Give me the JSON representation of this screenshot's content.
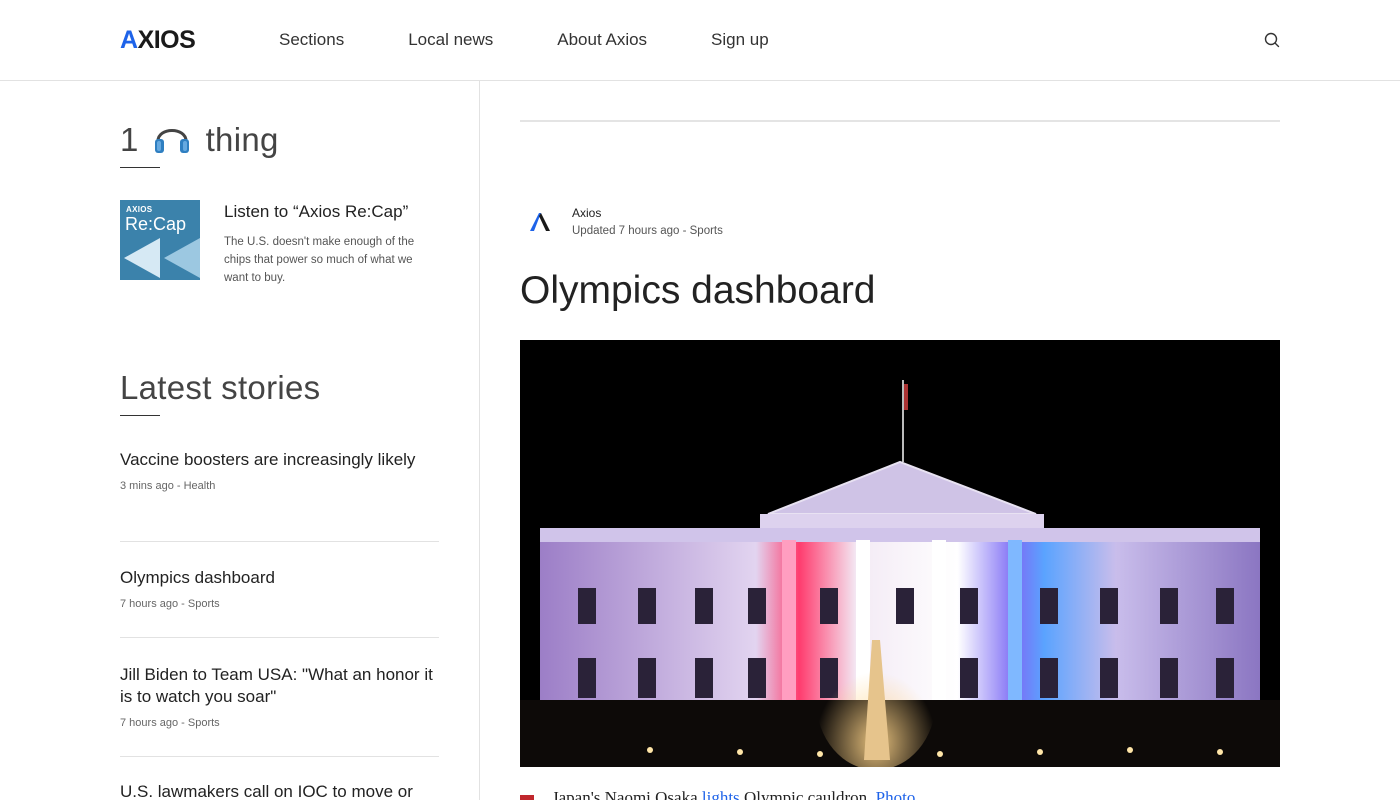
{
  "header": {
    "logo": "AXIOS",
    "nav": [
      "Sections",
      "Local news",
      "About Axios",
      "Sign up"
    ],
    "search_icon": "search-icon"
  },
  "one_thing": {
    "title_prefix": "1",
    "title_icon": "headphones-icon",
    "title_suffix": "thing",
    "thumb_brand": "AXIOS",
    "thumb_title": "Re:Cap",
    "item_title": "Listen to “Axios Re:Cap”",
    "item_desc": "The U.S. doesn't make enough of the chips that power so much of what we want to buy."
  },
  "latest": {
    "title": "Latest stories",
    "stories": [
      {
        "title": "Vaccine boosters are increasingly likely",
        "meta": "3 mins ago - Health"
      },
      {
        "title": "Olympics dashboard",
        "meta": "7 hours ago - Sports"
      },
      {
        "title": "Jill Biden to Team USA: \"What an honor it is to watch you soar\"",
        "meta": "7 hours ago - Sports"
      },
      {
        "title": "U.S. lawmakers call on IOC to move or",
        "meta": ""
      }
    ]
  },
  "article": {
    "author": "Axios",
    "meta": "Updated 7 hours ago - Sports",
    "headline": "Olympics dashboard",
    "caption_text": "Japan's Naomi Osaka ",
    "caption_link": "lights",
    "caption_text2": " Olympic cauldron. ",
    "caption_link2": "Photo"
  },
  "colors": {
    "accent": "#1e63e9",
    "bullet": "#c0272d"
  }
}
